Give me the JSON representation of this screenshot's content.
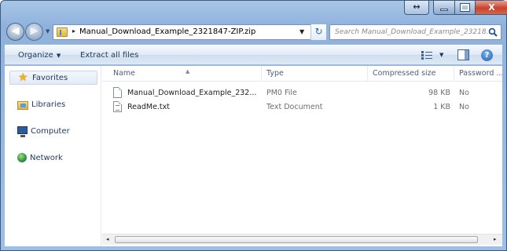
{
  "titlebar": {
    "tab_glyph": "↔",
    "close_glyph": "X"
  },
  "navigation": {
    "back_glyph": "◀",
    "forward_glyph": "▶",
    "recent_glyph": "▼"
  },
  "address": {
    "separator": "▸",
    "path": "Manual_Download_Example_2321847-ZIP.zip",
    "dropdown_glyph": "▼",
    "refresh_glyph": "↻"
  },
  "search": {
    "placeholder": "Search Manual_Download_Example_23218..."
  },
  "command_bar": {
    "organize_label": "Organize",
    "organize_caret": "▼",
    "extract_label": "Extract all files",
    "view_caret": "▼",
    "help_glyph": "?"
  },
  "nav_pane": {
    "items": [
      {
        "label": "Favorites",
        "icon": "star-icon"
      },
      {
        "label": "Libraries",
        "icon": "libraries-icon"
      },
      {
        "label": "Computer",
        "icon": "computer-icon"
      },
      {
        "label": "Network",
        "icon": "network-icon"
      }
    ]
  },
  "file_list": {
    "sort_glyph": "▲",
    "columns": [
      "Name",
      "Type",
      "Compressed size",
      "Password ..."
    ],
    "rows": [
      {
        "name": "Manual_Download_Example_232...",
        "type": "PM0 File",
        "compressed_size": "98 KB",
        "password": "No"
      },
      {
        "name": "ReadMe.txt",
        "type": "Text Document",
        "compressed_size": "1 KB",
        "password": "No"
      }
    ]
  },
  "scrollbar": {
    "left_glyph": "◂",
    "right_glyph": "▸"
  },
  "colors": {
    "frame": "#9ebfe5",
    "command_bar": "#dce8f5",
    "close_button": "#c7442d",
    "text": "#1e395b"
  }
}
